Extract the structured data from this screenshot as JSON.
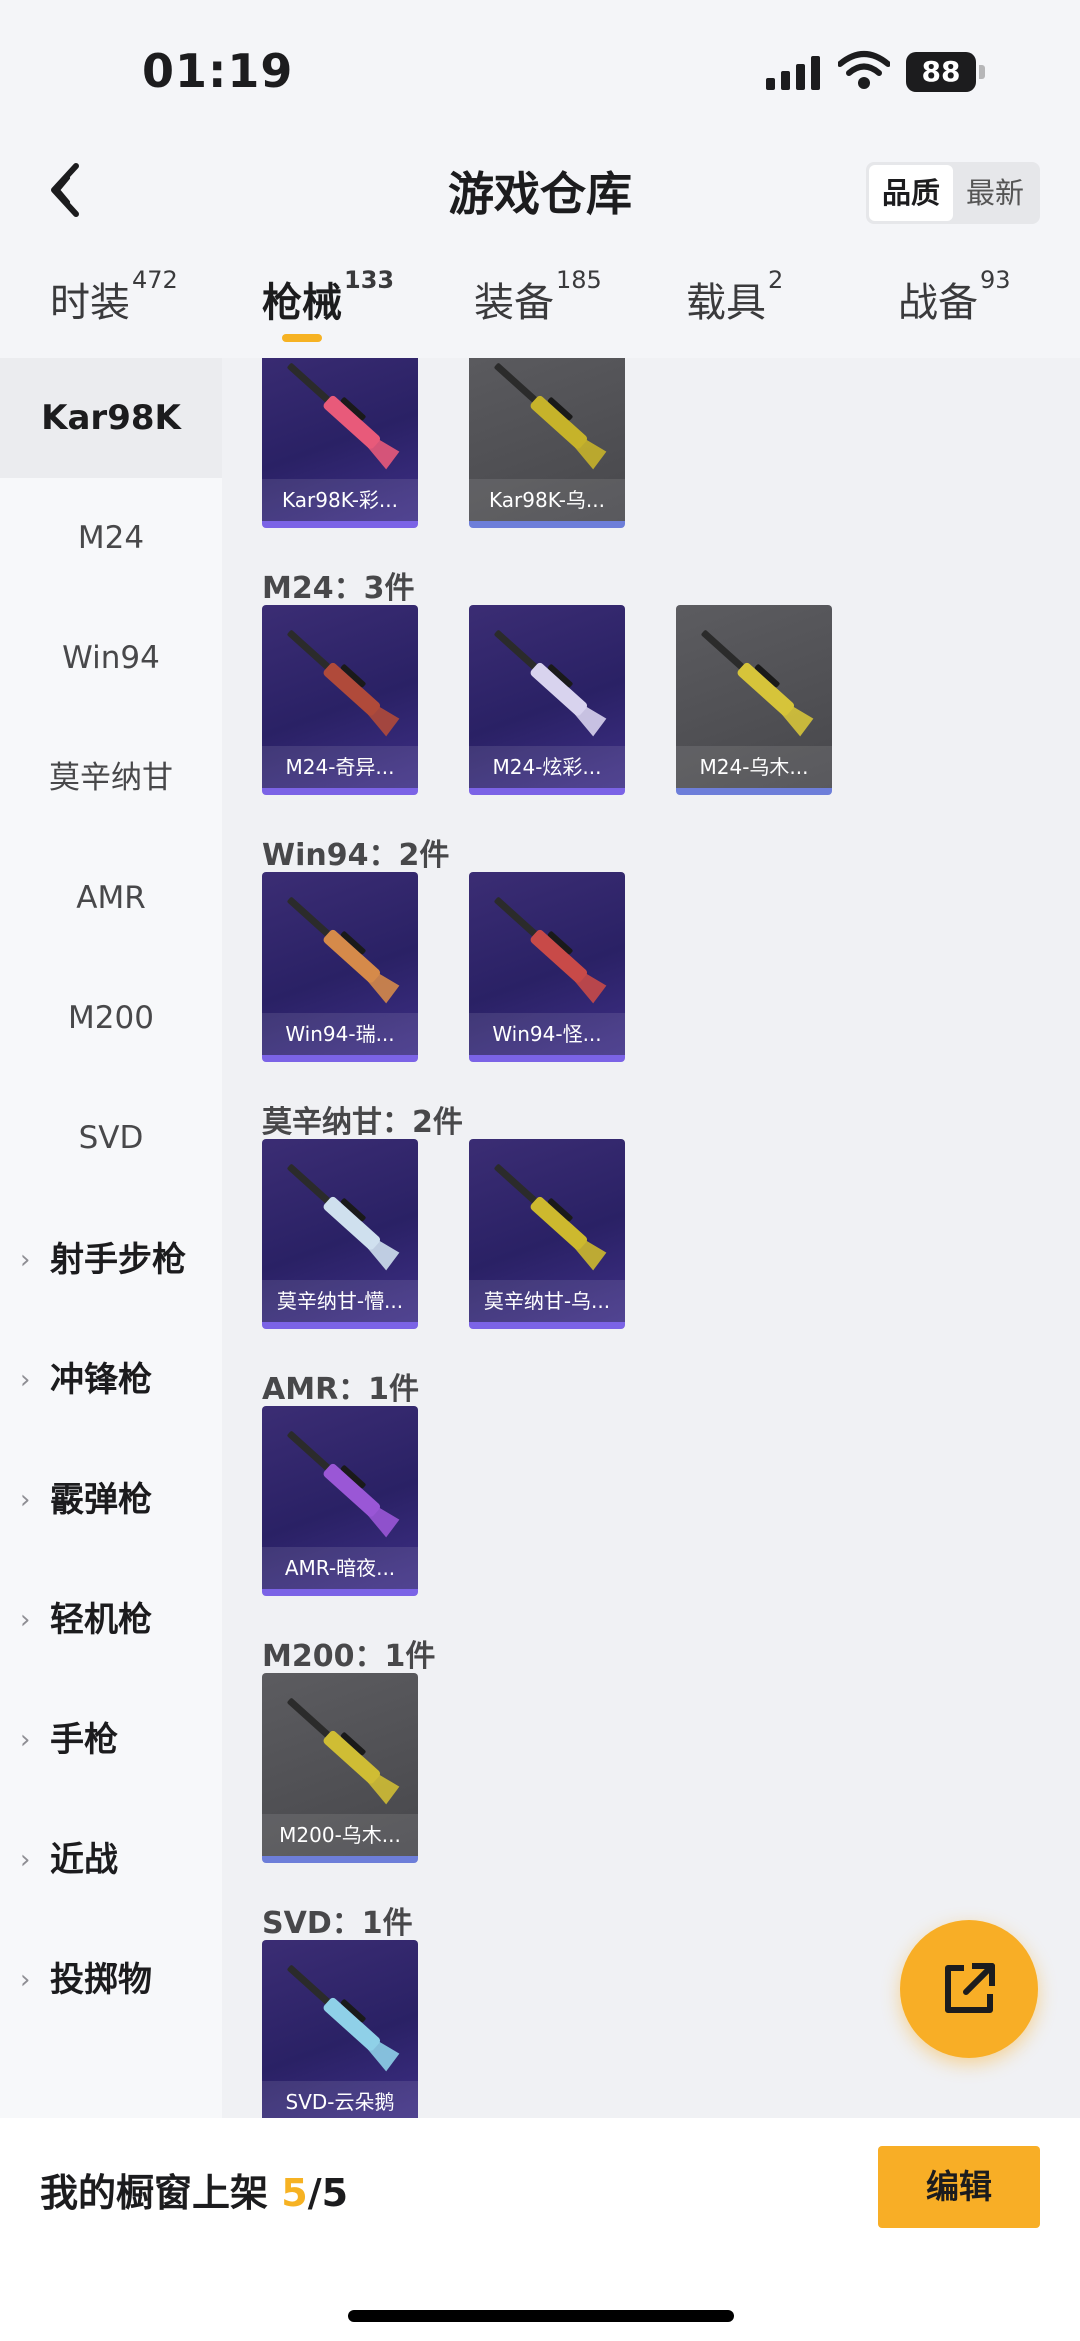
{
  "status_bar": {
    "time": "01:19",
    "battery": "88"
  },
  "header": {
    "title": "游戏仓库",
    "sort_options": [
      "品质",
      "最新"
    ],
    "sort_active": "品质"
  },
  "tabs": [
    {
      "label": "时装",
      "count": "472"
    },
    {
      "label": "枪械",
      "count": "133"
    },
    {
      "label": "装备",
      "count": "185"
    },
    {
      "label": "载具",
      "count": "2"
    },
    {
      "label": "战备",
      "count": "93"
    }
  ],
  "sidebar": {
    "guns": [
      "Kar98K",
      "M24",
      "Win94",
      "莫辛纳甘",
      "AMR",
      "M200",
      "SVD"
    ],
    "categories": [
      "射手步枪",
      "冲锋枪",
      "霰弹枪",
      "轻机枪",
      "手枪",
      "近战",
      "投掷物"
    ]
  },
  "sections": [
    {
      "title": "",
      "items": [
        {
          "label": "Kar98K-彩...",
          "tier": "purple",
          "color": "#e85a7a"
        },
        {
          "label": "Kar98K-乌...",
          "tier": "gray",
          "color": "#c6b32a"
        }
      ]
    },
    {
      "title": "M24：3件",
      "items": [
        {
          "label": "M24-奇异...",
          "tier": "purple",
          "color": "#b04a3a"
        },
        {
          "label": "M24-炫彩...",
          "tier": "purple",
          "color": "#d8d3ee"
        },
        {
          "label": "M24-乌木...",
          "tier": "gray",
          "color": "#d6c43a"
        }
      ]
    },
    {
      "title": "Win94：2件",
      "items": [
        {
          "label": "Win94-瑞...",
          "tier": "purple",
          "color": "#d58a4a"
        },
        {
          "label": "Win94-怪...",
          "tier": "purple",
          "color": "#c84a48"
        }
      ]
    },
    {
      "title": "莫辛纳甘：2件",
      "items": [
        {
          "label": "莫辛纳甘-懵...",
          "tier": "purple",
          "color": "#cfe0ee"
        },
        {
          "label": "莫辛纳甘-乌...",
          "tier": "purple",
          "color": "#cdb92e"
        }
      ]
    },
    {
      "title": "AMR：1件",
      "items": [
        {
          "label": "AMR-暗夜...",
          "tier": "purple",
          "color": "#9a57d6"
        }
      ]
    },
    {
      "title": "M200：1件",
      "items": [
        {
          "label": "M200-乌木...",
          "tier": "gray",
          "color": "#cfbd34"
        }
      ]
    },
    {
      "title": "SVD：1件",
      "items": [
        {
          "label": "SVD-云朵鹅",
          "tier": "purple",
          "color": "#8fd0e8"
        }
      ]
    }
  ],
  "bottom": {
    "prefix": "我的橱窗上架 ",
    "current": "5",
    "total": "/5",
    "edit_label": "编辑"
  }
}
